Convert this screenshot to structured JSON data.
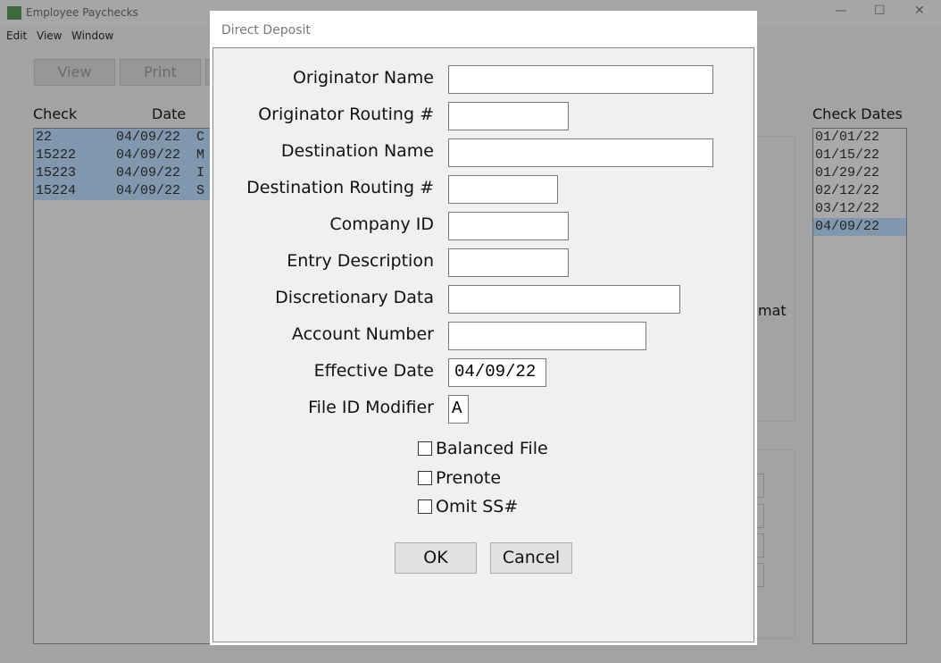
{
  "app": {
    "title": "Employee Paychecks",
    "menu": [
      "Edit",
      "View",
      "Window"
    ],
    "toolbar": {
      "view": "View",
      "print": "Print"
    }
  },
  "checks": {
    "headers": {
      "check": "Check",
      "date": "Date"
    },
    "rows": [
      {
        "check": "22",
        "date": "04/09/22",
        "name": "C"
      },
      {
        "check": "15222",
        "date": "04/09/22",
        "name": "M"
      },
      {
        "check": "15223",
        "date": "04/09/22",
        "name": "I"
      },
      {
        "check": "15224",
        "date": "04/09/22",
        "name": "S"
      }
    ]
  },
  "format_partial": "mat",
  "check_dates": {
    "header": "Check Dates",
    "items": [
      "01/01/22",
      "01/15/22",
      "01/29/22",
      "02/12/22",
      "03/12/22",
      "04/09/22"
    ],
    "selected": "04/09/22"
  },
  "dialog": {
    "title": "Direct Deposit",
    "fields": [
      {
        "label": "Originator Name",
        "value": ""
      },
      {
        "label": "Originator Routing #",
        "value": ""
      },
      {
        "label": "Destination Name",
        "value": ""
      },
      {
        "label": "Destination Routing #",
        "value": ""
      },
      {
        "label": "Company ID",
        "value": ""
      },
      {
        "label": "Entry Description",
        "value": ""
      },
      {
        "label": "Discretionary Data",
        "value": ""
      },
      {
        "label": "Account Number",
        "value": ""
      },
      {
        "label": "Effective Date",
        "value": "04/09/22"
      },
      {
        "label": "File ID Modifier",
        "value": "A"
      }
    ],
    "checkboxes": [
      {
        "label": "Balanced File",
        "checked": false
      },
      {
        "label": "Prenote",
        "checked": false
      },
      {
        "label": "Omit SS#",
        "checked": false
      }
    ],
    "ok": "OK",
    "cancel": "Cancel"
  }
}
